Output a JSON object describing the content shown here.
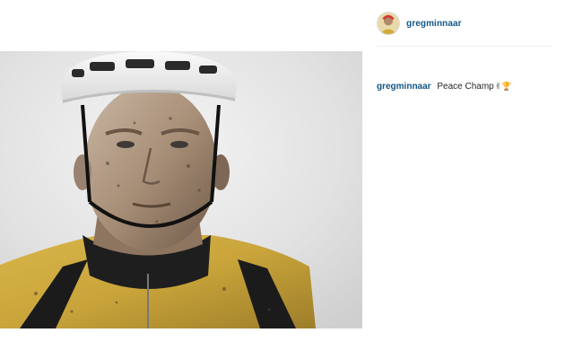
{
  "post": {
    "username": "gregminnaar",
    "avatar_icon": "profile-photo-icon",
    "photo_icon": "cyclist-portrait-photo",
    "caption": {
      "username": "gregminnaar",
      "text": "Peace Champ",
      "glyphs": "✌🏆"
    }
  },
  "colors": {
    "username": "#125688",
    "text": "#262626",
    "divider": "#efefef",
    "jersey": "#c9a43a"
  }
}
